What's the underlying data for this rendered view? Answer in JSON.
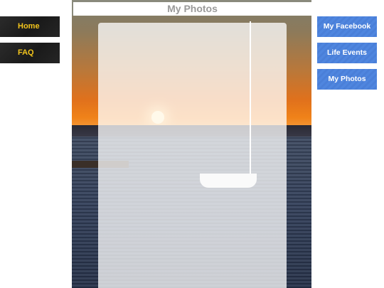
{
  "left_nav": {
    "items": [
      {
        "label": "Home"
      },
      {
        "label": "FAQ"
      }
    ]
  },
  "right_nav": {
    "items": [
      {
        "label": "My Facebook"
      },
      {
        "label": "Life Events"
      },
      {
        "label": "My Photos"
      }
    ]
  },
  "main": {
    "title": "My Photos"
  },
  "colors": {
    "left_button_bg": "#1f1f1f",
    "left_button_text": "#f2c41c",
    "right_button_bg": "#4f86df",
    "right_button_text": "#ffffff",
    "title_text": "#9a9a9a"
  }
}
